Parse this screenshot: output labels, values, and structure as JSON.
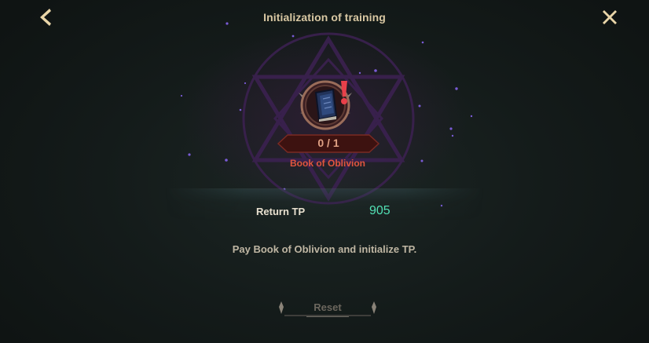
{
  "header": {
    "title": "Initialization of training",
    "back_icon": "chevron-left-icon",
    "close_icon": "close-icon"
  },
  "item": {
    "name": "Book of Oblivion",
    "count": "0 / 1",
    "icon": "book-icon",
    "alert_icon": "exclamation-icon"
  },
  "return_tp": {
    "label": "Return TP",
    "value": "905"
  },
  "description": "Pay Book of Oblivion and initialize TP.",
  "actions": {
    "reset_label": "Reset"
  },
  "colors": {
    "accent_gold": "#d9c8a3",
    "item_name_red": "#e0553e",
    "tp_value_green": "#52e0b4",
    "disabled_text": "#6b665d"
  }
}
